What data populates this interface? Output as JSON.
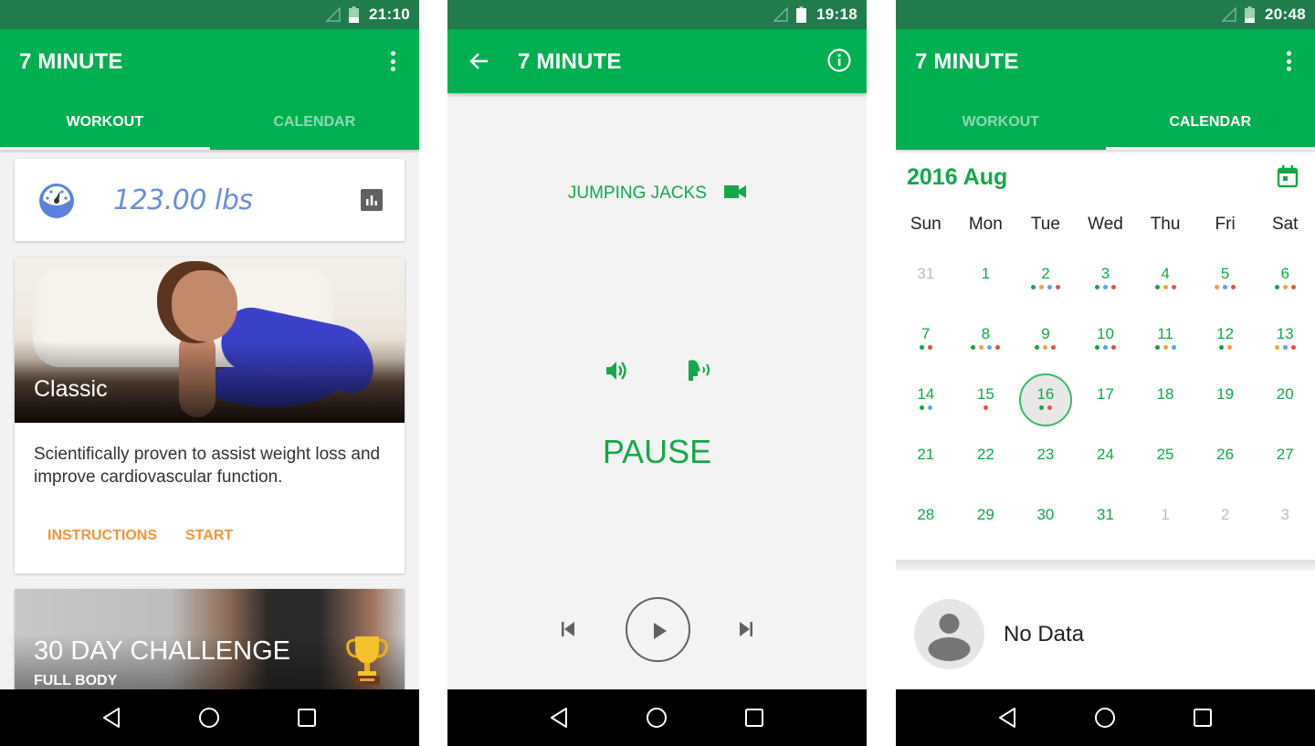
{
  "colors": {
    "status_bar": "#217c4c",
    "primary": "#00b050",
    "accent_text": "#14a84a",
    "action_orange": "#f7953a",
    "weight_blue": "#6c8ddf",
    "dot_green": "#0cab3f",
    "dot_orange": "#f7a03c",
    "dot_blue": "#4fa7f5",
    "dot_red": "#f04b42"
  },
  "screens": [
    {
      "status": {
        "time": "21:10"
      },
      "app_title": "7 MINUTE",
      "tabs": [
        {
          "label": "WORKOUT",
          "active": true
        },
        {
          "label": "CALENDAR",
          "active": false
        }
      ],
      "weight": {
        "value": "123.00 lbs"
      },
      "classic": {
        "title": "Classic",
        "description": "Scientifically proven to assist weight loss and improve cardiovascular function.",
        "actions": [
          "INSTRUCTIONS",
          "START"
        ]
      },
      "challenge": {
        "title": "30 DAY CHALLENGE",
        "subtitle": "FULL BODY"
      }
    },
    {
      "status": {
        "time": "19:18"
      },
      "app_title": "7 MINUTE",
      "exercise_name": "JUMPING JACKS",
      "state_label": "PAUSE"
    },
    {
      "status": {
        "time": "20:48"
      },
      "app_title": "7 MINUTE",
      "tabs": [
        {
          "label": "WORKOUT",
          "active": false
        },
        {
          "label": "CALENDAR",
          "active": true
        }
      ],
      "calendar": {
        "month_label": "2016 Aug",
        "weekdays": [
          "Sun",
          "Mon",
          "Tue",
          "Wed",
          "Thu",
          "Fri",
          "Sat"
        ],
        "selected_day": "16",
        "days": [
          {
            "n": "31",
            "other": true,
            "dots": []
          },
          {
            "n": "1",
            "dots": []
          },
          {
            "n": "2",
            "dots": [
              "green",
              "orange",
              "blue",
              "red"
            ]
          },
          {
            "n": "3",
            "dots": [
              "green",
              "blue",
              "red"
            ]
          },
          {
            "n": "4",
            "dots": [
              "green",
              "orange",
              "red"
            ]
          },
          {
            "n": "5",
            "dots": [
              "orange",
              "blue",
              "red"
            ]
          },
          {
            "n": "6",
            "dots": [
              "green",
              "orange",
              "red"
            ]
          },
          {
            "n": "7",
            "dots": [
              "green",
              "red"
            ]
          },
          {
            "n": "8",
            "dots": [
              "green",
              "orange",
              "blue",
              "red"
            ]
          },
          {
            "n": "9",
            "dots": [
              "green",
              "orange",
              "red"
            ]
          },
          {
            "n": "10",
            "dots": [
              "green",
              "blue",
              "red"
            ]
          },
          {
            "n": "11",
            "dots": [
              "green",
              "orange",
              "blue"
            ]
          },
          {
            "n": "12",
            "dots": [
              "green",
              "orange"
            ]
          },
          {
            "n": "13",
            "dots": [
              "orange",
              "blue",
              "red"
            ]
          },
          {
            "n": "14",
            "dots": [
              "green",
              "blue"
            ]
          },
          {
            "n": "15",
            "dots": [
              "red"
            ]
          },
          {
            "n": "16",
            "dots": [
              "green",
              "red"
            ],
            "selected": true
          },
          {
            "n": "17",
            "dots": []
          },
          {
            "n": "18",
            "dots": []
          },
          {
            "n": "19",
            "dots": []
          },
          {
            "n": "20",
            "dots": []
          },
          {
            "n": "21",
            "dots": []
          },
          {
            "n": "22",
            "dots": []
          },
          {
            "n": "23",
            "dots": []
          },
          {
            "n": "24",
            "dots": []
          },
          {
            "n": "25",
            "dots": []
          },
          {
            "n": "26",
            "dots": []
          },
          {
            "n": "27",
            "dots": []
          },
          {
            "n": "28",
            "dots": []
          },
          {
            "n": "29",
            "dots": []
          },
          {
            "n": "30",
            "dots": []
          },
          {
            "n": "31",
            "dots": []
          },
          {
            "n": "1",
            "other": true,
            "dots": []
          },
          {
            "n": "2",
            "other": true,
            "dots": []
          },
          {
            "n": "3",
            "other": true,
            "dots": []
          }
        ]
      },
      "no_data_label": "No Data"
    }
  ],
  "icons": {
    "status": [
      "signal-icon",
      "battery-icon"
    ],
    "navbar": [
      "back-triangle-icon",
      "home-circle-icon",
      "recents-square-icon"
    ],
    "workout": [
      "gauge-icon",
      "bar-chart-icon",
      "trophy-icon"
    ],
    "player": [
      "arrow-back-icon",
      "info-icon",
      "video-camera-icon",
      "volume-icon",
      "voice-icon",
      "skip-previous-icon",
      "play-icon",
      "skip-next-icon"
    ],
    "calendar": [
      "calendar-today-icon",
      "person-avatar-icon"
    ]
  }
}
